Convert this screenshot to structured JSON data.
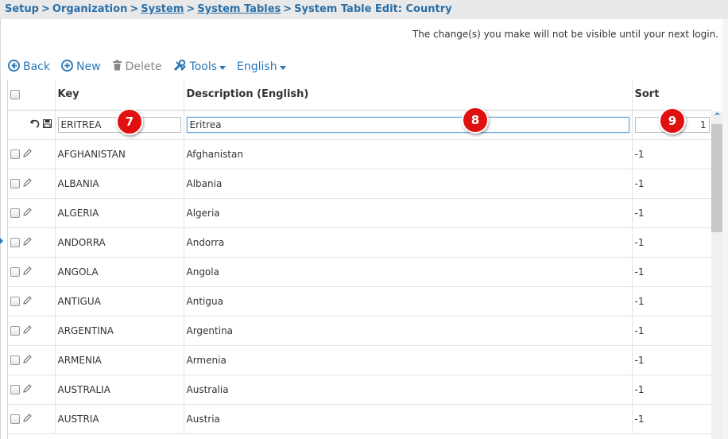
{
  "breadcrumb": {
    "items": [
      {
        "label": "Setup",
        "link": false
      },
      {
        "label": "Organization",
        "link": false
      },
      {
        "label": "System",
        "link": true
      },
      {
        "label": "System Tables",
        "link": true
      },
      {
        "label": "System Table Edit: Country",
        "link": false
      }
    ],
    "separator": ">"
  },
  "notice": "The change(s) you make will not be visible until your next login.",
  "toolbar": {
    "back_label": "Back",
    "new_label": "New",
    "delete_label": "Delete",
    "tools_label": "Tools",
    "language_label": "English"
  },
  "grid": {
    "columns": {
      "key": "Key",
      "description": "Description (English)",
      "sort": "Sort"
    },
    "edit_row": {
      "key": "ERITREA",
      "description": "Eritrea",
      "sort": "1"
    },
    "rows": [
      {
        "key": "AFGHANISTAN",
        "description": "Afghanistan",
        "sort": "-1"
      },
      {
        "key": "ALBANIA",
        "description": "Albania",
        "sort": "-1"
      },
      {
        "key": "ALGERIA",
        "description": "Algeria",
        "sort": "-1"
      },
      {
        "key": "ANDORRA",
        "description": "Andorra",
        "sort": "-1"
      },
      {
        "key": "ANGOLA",
        "description": "Angola",
        "sort": "-1"
      },
      {
        "key": "ANTIGUA",
        "description": "Antigua",
        "sort": "-1"
      },
      {
        "key": "ARGENTINA",
        "description": "Argentina",
        "sort": "-1"
      },
      {
        "key": "ARMENIA",
        "description": "Armenia",
        "sort": "-1"
      },
      {
        "key": "AUSTRALIA",
        "description": "Australia",
        "sort": "-1"
      },
      {
        "key": "AUSTRIA",
        "description": "Austria",
        "sort": "-1"
      }
    ]
  },
  "badges": {
    "key": "7",
    "description": "8",
    "sort": "9"
  },
  "icons": {
    "back": "circle-arrow-left-icon",
    "new": "circle-plus-icon",
    "delete": "trash-icon",
    "tools": "tools-icon",
    "undo": "undo-icon",
    "save": "floppy-disk-icon",
    "edit": "pencil-icon",
    "scroll_up": "chevron-up-icon"
  },
  "colors": {
    "link": "#2a78b8",
    "badge": "#e01010",
    "breadcrumb_bg": "#e9e9e9"
  }
}
